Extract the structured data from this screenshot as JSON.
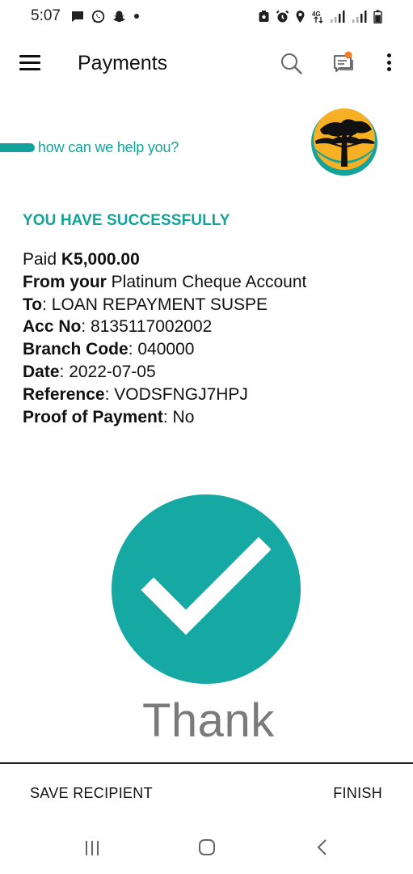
{
  "status_bar": {
    "time": "5:07",
    "left_icons": [
      "message-icon",
      "whatsapp-icon",
      "snapchat-icon",
      "dot-icon"
    ],
    "right_icons": [
      "sync-icon",
      "alarm-icon",
      "location-icon",
      "4g-icon",
      "signal-icon",
      "signal-icon",
      "battery-icon"
    ],
    "network_label": "4G"
  },
  "app_bar": {
    "title": "Payments",
    "notification_color": "#f07e26"
  },
  "banner": {
    "tagline": "how can we help you?",
    "brand_color": "#13a39b",
    "logo_colors": {
      "sun": "#f7b024",
      "ring": "#13a39b",
      "tree": "#111111"
    }
  },
  "confirmation": {
    "heading": "YOU HAVE SUCCESSFULLY",
    "paid_label": "Paid ",
    "paid_amount": "K5,000.00",
    "from_label": "From your",
    "from_value": " Platinum Cheque Account",
    "to_label": "To",
    "to_value": ": LOAN REPAYMENT SUSPE",
    "acc_label": "Acc No",
    "acc_value": ": 8135117002002",
    "branch_label": "Branch Code",
    "branch_value": ": 040000",
    "date_label": "Date",
    "date_value": ": 2022-07-05",
    "reference_label": "Reference",
    "reference_value": ": VODSFNGJ7HPJ",
    "proof_label": "Proof of Payment",
    "proof_value": ": No",
    "thank_text": "Thank",
    "check_color": "#16a8a3"
  },
  "actions": {
    "save_recipient": "SAVE RECIPIENT",
    "finish": "FINISH"
  },
  "nav": {
    "icons": [
      "recent-apps-icon",
      "home-icon",
      "back-icon"
    ]
  }
}
